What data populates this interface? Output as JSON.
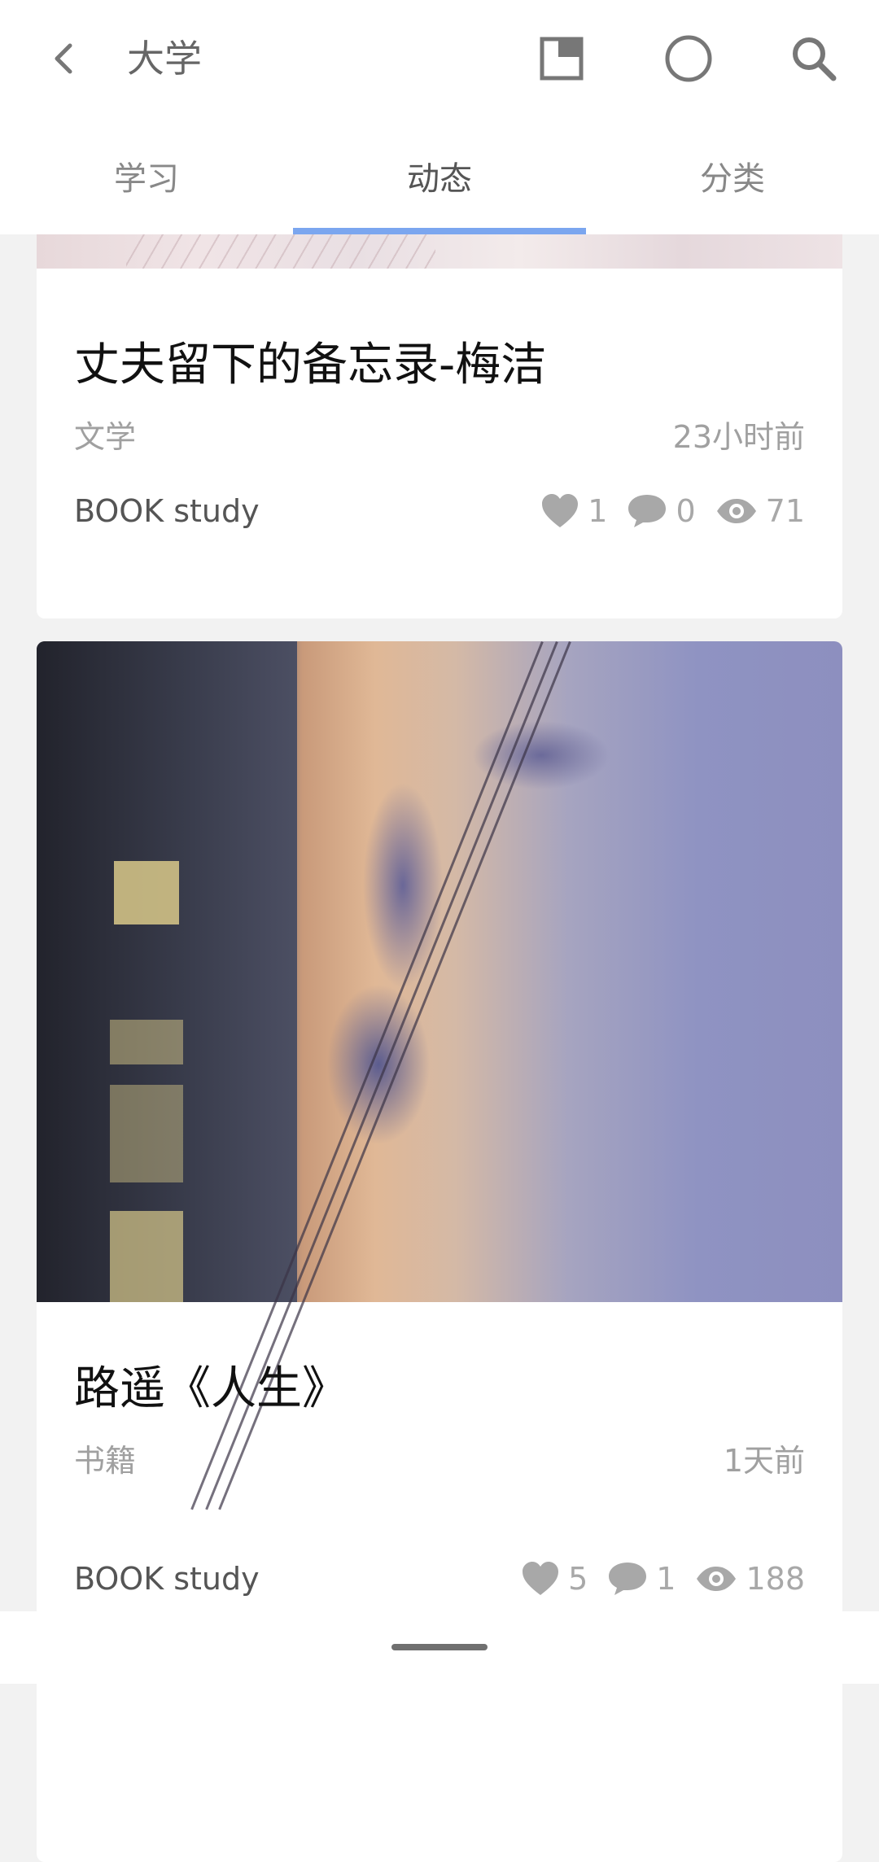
{
  "header": {
    "title": "大学",
    "icons": [
      "back-arrow-icon",
      "window-icon",
      "circle-icon",
      "search-icon"
    ]
  },
  "tabs": [
    {
      "label": "学习",
      "active": false
    },
    {
      "label": "动态",
      "active": true
    },
    {
      "label": "分类",
      "active": false
    }
  ],
  "accent_color": "#7ba6ef",
  "posts": [
    {
      "title": "丈夫留下的备忘录-梅洁",
      "category": "文学",
      "time": "23小时前",
      "author": "BOOK study",
      "likes": "1",
      "comments": "0",
      "views": "71"
    },
    {
      "title": "路遥《人生》",
      "category": "书籍",
      "time": "1天前",
      "author": "BOOK study",
      "likes": "5",
      "comments": "1",
      "views": "188"
    }
  ]
}
